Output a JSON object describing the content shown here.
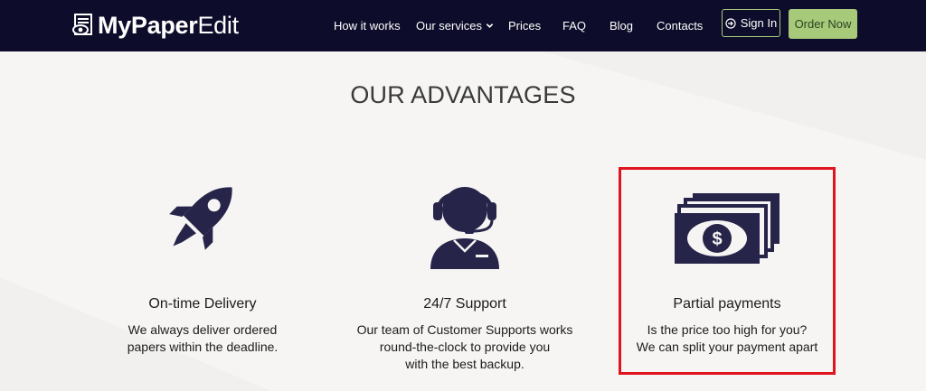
{
  "header": {
    "logo": {
      "part1": "MyPaper",
      "part2": "Edit"
    },
    "nav": [
      {
        "label": "How it works"
      },
      {
        "label": "Our services"
      },
      {
        "label": "Prices"
      },
      {
        "label": "FAQ"
      },
      {
        "label": "Blog"
      },
      {
        "label": "Contacts"
      }
    ],
    "signin_label": "Sign In",
    "order_label": "Order Now"
  },
  "main": {
    "title": "OUR ADVANTAGES",
    "cards": [
      {
        "icon": "rocket-icon",
        "title": "On-time Delivery",
        "desc": [
          "We always deliver ordered",
          "papers within the deadline."
        ]
      },
      {
        "icon": "support-agent-icon",
        "title": "24/7 Support",
        "desc": [
          "Our team of Customer Supports works",
          "round-the-clock to provide you",
          "with the best backup."
        ]
      },
      {
        "icon": "money-bills-icon",
        "title": "Partial payments",
        "desc": [
          "Is the price too high for you?",
          "We can split your payment apart"
        ]
      }
    ]
  },
  "colors": {
    "navbar_bg": "#0d0c2a",
    "accent_green": "#a6c97a",
    "icon_navy": "#27244a",
    "highlight_red": "#e0141e"
  }
}
